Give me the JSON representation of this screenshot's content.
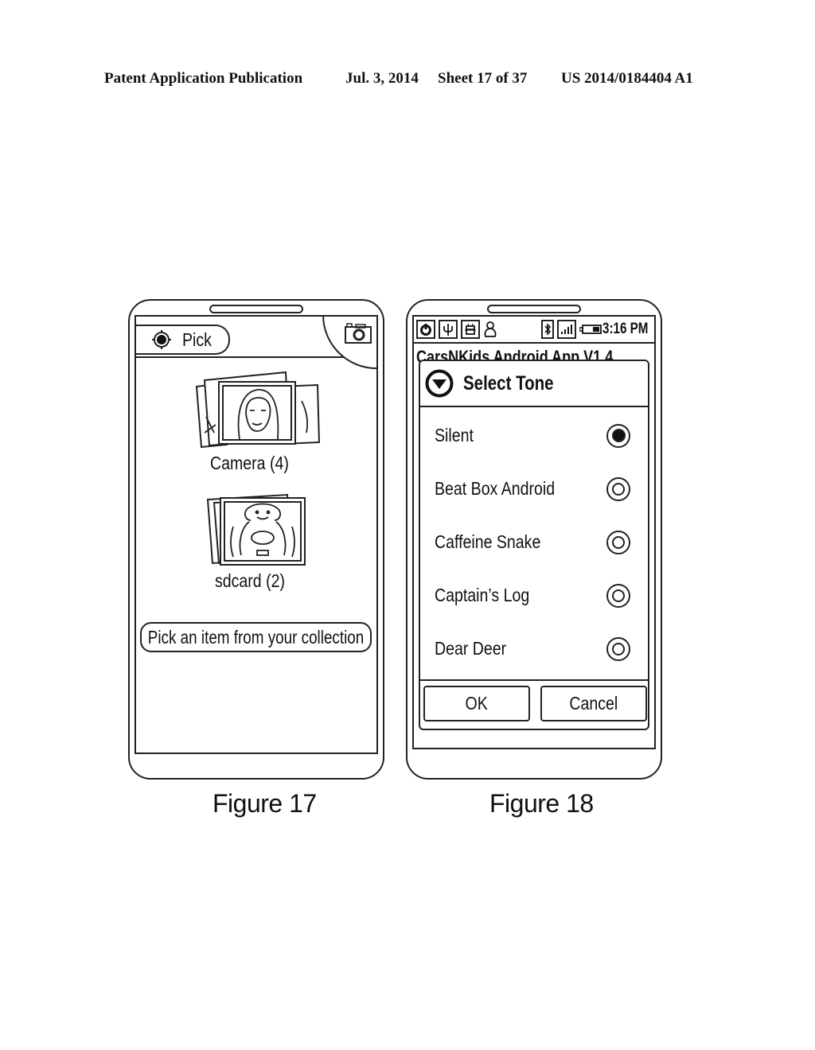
{
  "header": {
    "publication": "Patent Application Publication",
    "date": "Jul. 3, 2014",
    "sheet": "Sheet 17 of 37",
    "number": "US 2014/0184404 A1"
  },
  "figure17": {
    "caption": "Figure 17",
    "pick_button": {
      "label": "Pick",
      "icon": "target-icon"
    },
    "camera_icon": "camera-icon",
    "albums": [
      {
        "label": "Camera (4)",
        "thumbnail": "woman-photo-stack"
      },
      {
        "label": "sdcard (2)",
        "thumbnail": "child-photo-stack"
      }
    ],
    "collection_button": "Pick an item from your collection"
  },
  "figure18": {
    "caption": "Figure 18",
    "status_bar": {
      "left_icons": [
        "power-icon",
        "usb-icon",
        "android-debug-icon",
        "person-icon"
      ],
      "right_icons": [
        "bluetooth-icon",
        "signal-icon",
        "battery-icon"
      ],
      "time": "3:16 PM"
    },
    "app_title": "CarsNKids Android App V1.4",
    "dialog": {
      "title": "Select Tone",
      "options": [
        {
          "label": "Silent",
          "selected": true
        },
        {
          "label": "Beat Box Android",
          "selected": false
        },
        {
          "label": "Caffeine Snake",
          "selected": false
        },
        {
          "label": "Captain’s Log",
          "selected": false
        },
        {
          "label": "Dear Deer",
          "selected": false
        }
      ],
      "ok_label": "OK",
      "cancel_label": "Cancel"
    }
  }
}
